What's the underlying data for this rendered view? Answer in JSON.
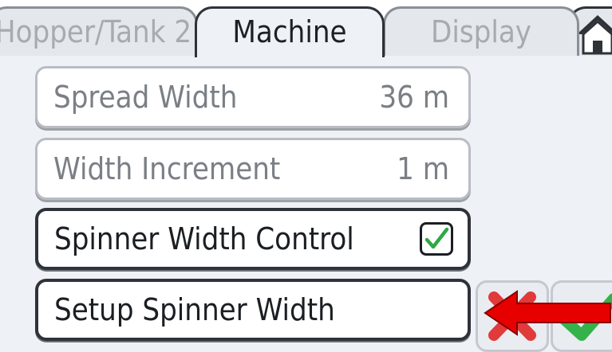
{
  "tabs": [
    {
      "label": "Hopper/Tank 2",
      "state": "inactive"
    },
    {
      "label": "Machine",
      "state": "active"
    },
    {
      "label": "Display",
      "state": "inactive"
    }
  ],
  "home_icon": "home-icon",
  "settings": {
    "spread_width": {
      "label": "Spread Width",
      "value": "36 m",
      "enabled": false
    },
    "width_increment": {
      "label": "Width Increment",
      "value": "1 m",
      "enabled": false
    },
    "spinner_width_control": {
      "label": "Spinner Width Control",
      "checked": true
    },
    "setup_spinner_width": {
      "label": "Setup Spinner Width"
    }
  },
  "side_buttons": [
    {
      "icon": "red-cross-icon",
      "color": "#e03a3a"
    },
    {
      "icon": "green-check-icon",
      "color": "#35b24a"
    }
  ],
  "annotation": {
    "icon": "red-arrow-icon",
    "color": "#e60000"
  },
  "colors": {
    "check": "#2fa844",
    "arrow": "#e60000",
    "border_dark": "#2e3339",
    "background": "#eef1f5"
  }
}
